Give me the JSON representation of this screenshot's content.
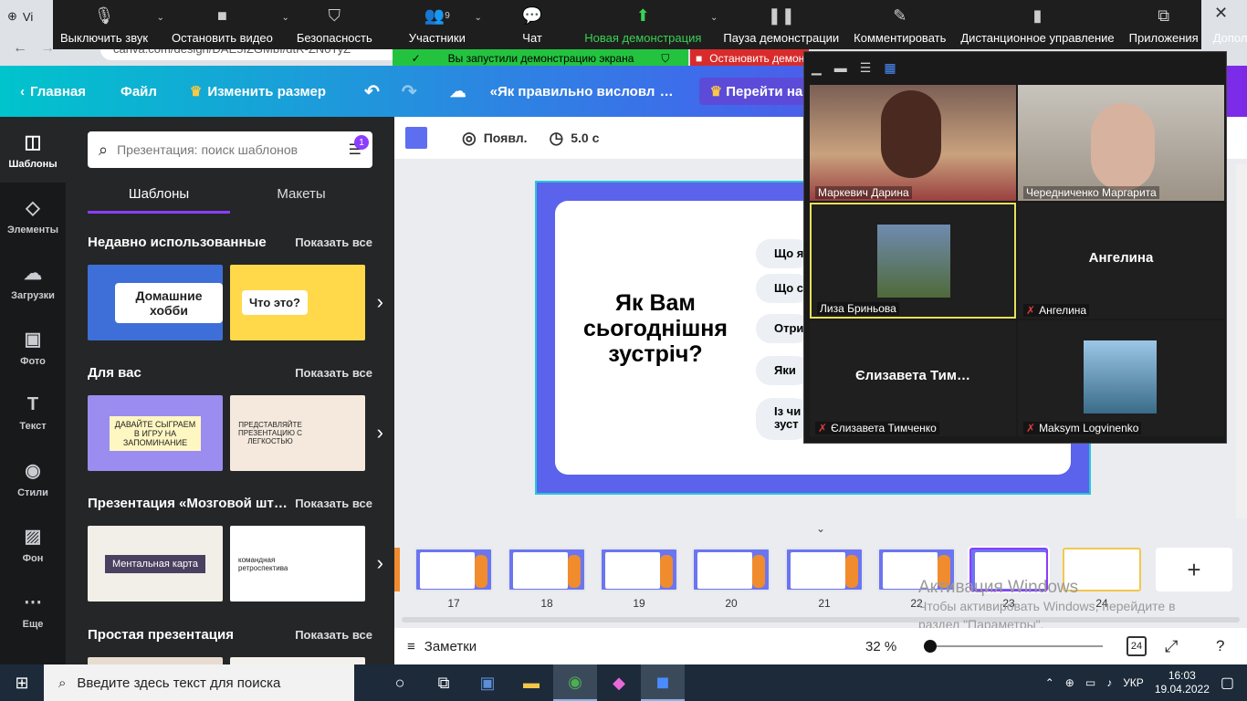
{
  "browser": {
    "tab_title": "Vi",
    "address": "canva.com/design/DAE5IZGMbI/dtR-ZN0TyZ"
  },
  "zoom_toolbar": {
    "items": [
      {
        "label": "Выключить звук",
        "icon": "microphone-icon"
      },
      {
        "label": "Остановить видео",
        "icon": "video-camera-icon"
      },
      {
        "label": "Безопасность",
        "icon": "shield-icon"
      },
      {
        "label": "Участники",
        "icon": "participants-icon",
        "count": "9"
      },
      {
        "label": "Чат",
        "icon": "chat-icon"
      },
      {
        "label": "Новая демонстрация",
        "icon": "share-screen-icon"
      },
      {
        "label": "Пауза демонстрации",
        "icon": "pause-icon"
      },
      {
        "label": "Комментировать",
        "icon": "pencil-icon"
      },
      {
        "label": "Дистанционное управление",
        "icon": "mouse-icon"
      },
      {
        "label": "Приложения",
        "icon": "apps-icon"
      },
      {
        "label": "Дополнительно",
        "icon": "more-icon"
      }
    ],
    "share_banner": "Вы запустили демонстрацию экрана",
    "stop_banner": "Остановить демонстрацию",
    "accent_green": "#23c340",
    "stop_red": "#d92b2b"
  },
  "canva_header": {
    "home": "Главная",
    "file": "Файл",
    "resize": "Изменить размер",
    "doc_title": "«Як правильно висловлювати свою думку»",
    "goto": "Перейти на Canva Pro"
  },
  "rail": [
    {
      "label": "Шаблоны",
      "icon": "templates-icon"
    },
    {
      "label": "Элементы",
      "icon": "elements-icon"
    },
    {
      "label": "Загрузки",
      "icon": "upload-icon"
    },
    {
      "label": "Фото",
      "icon": "photo-icon"
    },
    {
      "label": "Текст",
      "icon": "text-icon"
    },
    {
      "label": "Стили",
      "icon": "palette-icon"
    },
    {
      "label": "Фон",
      "icon": "background-icon"
    },
    {
      "label": "Еще",
      "icon": "more-dots-icon"
    }
  ],
  "panel": {
    "search_placeholder": "Презентация: поиск шаблонов",
    "filter_badge": "1",
    "tabs": [
      "Шаблоны",
      "Макеты"
    ],
    "show_all": "Показать все",
    "sections": [
      {
        "title": "Недавно использованные",
        "thumbs": [
          "Домашние хобби",
          "Что это?"
        ]
      },
      {
        "title": "Для вас",
        "thumbs": [
          "ДАВАЙТЕ СЫГРАЕМ В ИГРУ НА ЗАПОМИНАНИЕ",
          "ПРЕДСТАВЛЯЙТЕ ПРЕЗЕНТАЦИЮ С ЛЕГКОСТЬЮ"
        ]
      },
      {
        "title": "Презентация «Мозговой шт…",
        "thumbs": [
          "Ментальная карта",
          "командная ретроспектива"
        ]
      },
      {
        "title": "Простая презентация",
        "thumbs": [
          "",
          ""
        ]
      }
    ]
  },
  "editor_toolbar": {
    "animate": "Появл.",
    "duration": "5.0 с",
    "slide_color": "#5b62ec"
  },
  "slide": {
    "title": "Як Вам сьогоднішня зустріч?",
    "options": [
      "Що я",
      "Що сп",
      "Отри",
      "Яки",
      "Із чи\nзуст"
    ]
  },
  "filmstrip": {
    "pages": [
      "17",
      "18",
      "19",
      "20",
      "21",
      "22",
      "23",
      "24"
    ],
    "current": "23"
  },
  "bottom_bar": {
    "notes": "Заметки",
    "zoom": "32 %",
    "page_count": "24"
  },
  "windows_watermark": {
    "line1": "Активация Windows",
    "line2": "Чтобы активировать Windows, перейдите в раздел \"Параметры\"."
  },
  "gallery": {
    "participants": [
      {
        "name": "Маркевич Дарина",
        "muted": false,
        "video": true
      },
      {
        "name": "Чередниченко Маргарита",
        "muted": false,
        "video": true
      },
      {
        "name": "Лиза Бриньова",
        "muted": false,
        "video": true,
        "active": true
      },
      {
        "name": "Ангелина",
        "muted": true,
        "video": false,
        "big": "Ангелина"
      },
      {
        "name": "Єлизавета Тимченко",
        "muted": true,
        "video": false,
        "big": "Єлизавета  Тим…"
      },
      {
        "name": "Maksym Logvinenko",
        "muted": true,
        "video": true
      }
    ]
  },
  "taskbar": {
    "search": "Введите здесь текст для поиска",
    "lang": "УКР",
    "time": "16:03",
    "date": "19.04.2022"
  }
}
